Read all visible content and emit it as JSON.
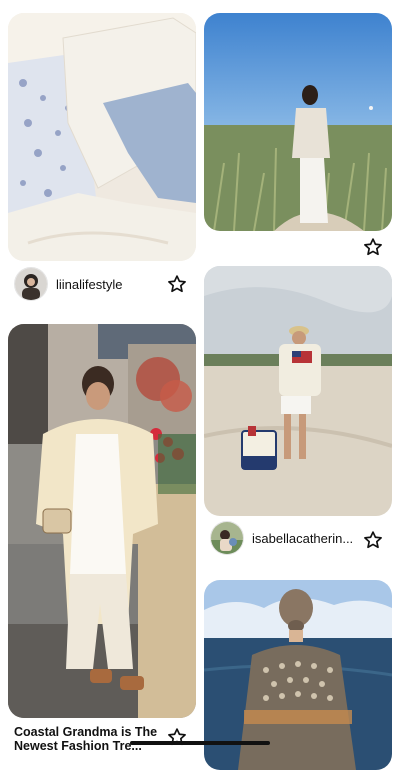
{
  "feed": {
    "pins": [
      {
        "id": "bedding",
        "image": "bedding-photo"
      },
      {
        "id": "dunes",
        "image": "dunes-photo"
      },
      {
        "id": "beach-flag",
        "image": "beach-photo"
      },
      {
        "id": "coastal-grandma",
        "image": "coastal-grandma-photo"
      },
      {
        "id": "sweater-sea",
        "image": "sweater-sea-photo"
      }
    ],
    "creators": [
      {
        "name": "liinalifestyle",
        "icon": "star-icon"
      },
      {
        "name": "isabellacatherin...",
        "icon": "star-icon"
      }
    ],
    "captions": [
      {
        "title": "Coastal Grandma is The Newest Fashion Tre..."
      }
    ]
  }
}
